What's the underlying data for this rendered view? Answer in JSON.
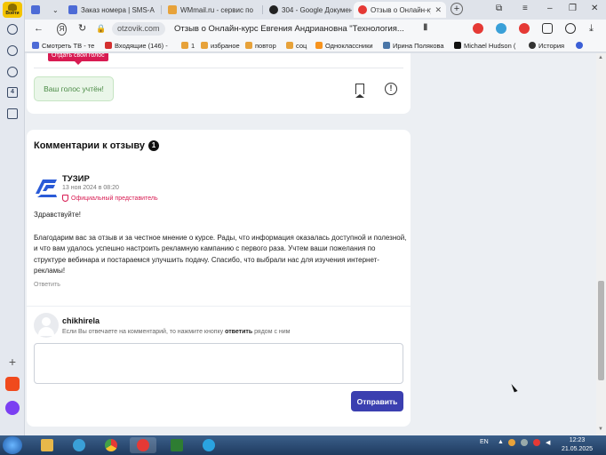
{
  "sidebar": {
    "login_label": "Войти",
    "badge_count": "4"
  },
  "tabs": [
    {
      "label": "Заказ номера | SMS-A",
      "color": "#4d6bd6"
    },
    {
      "label": "WMmail.ru - сервис по",
      "color": "#e7a23a"
    },
    {
      "label": "304 - Google Докумен",
      "color": "#222222"
    },
    {
      "label": "Отзыв о Онлайн-курс",
      "color": "#e53935"
    }
  ],
  "address": {
    "host": "otzovik.com",
    "title": "Отзыв о Онлайн-курс Евгения Андриановна \"Технология..."
  },
  "bookmarks": [
    {
      "label": "Смотреть ТВ - те",
      "color": "#4d6bd6"
    },
    {
      "label": "Входящие (146) -",
      "color": "#d32f2f"
    },
    {
      "label": "1",
      "color": "#e7a23a"
    },
    {
      "label": "избраное",
      "color": "#e7a23a"
    },
    {
      "label": "повтор",
      "color": "#e7a23a"
    },
    {
      "label": "соц",
      "color": "#e7a23a"
    },
    {
      "label": "Одноклассники",
      "color": "#f7931e"
    },
    {
      "label": "Ирина Полякова",
      "color": "#4a76a8"
    },
    {
      "label": "Michael Hudson (",
      "color": "#111111"
    },
    {
      "label": "История",
      "color": "#333333"
    }
  ],
  "vote": {
    "tooltip": "Отдать свой голос",
    "voted_label": "Ваш голос учтён!"
  },
  "comments": {
    "title": "Комментарии к отзыву",
    "count": "1",
    "items": [
      {
        "author": "ТУЗИР",
        "date": "13 ноя 2024 в 08:20",
        "role": "Официальный представитель",
        "greeting": "Здравствуйте!",
        "body": "Благодарим вас за отзыв и за честное мнение о курсе. Рады, что информация оказалась доступной и полезной, и что вам удалось успешно настроить рекламную кампанию с первого раза. Учтем ваши пожелания по структуре вебинара и постараемся улучшить подачу. Спасибо, что выбрали нас для изучения интернет-рекламы!",
        "reply_label": "Ответить"
      }
    ]
  },
  "reply_form": {
    "user": "chikhirela",
    "hint_before": "Если Вы отвечаете на комментарий, то нажмите кнопку",
    "hint_bold": "ответить",
    "hint_after": "рядом с ним",
    "textarea_value": "",
    "submit_label": "Отправить"
  },
  "taskbar": {
    "lang": "EN",
    "time": "12:23",
    "date": "21.05.2025"
  },
  "colors": {
    "accent": "#3b3fb0",
    "brand_red": "#d81b52",
    "voted_bg": "#eaf6e9"
  }
}
